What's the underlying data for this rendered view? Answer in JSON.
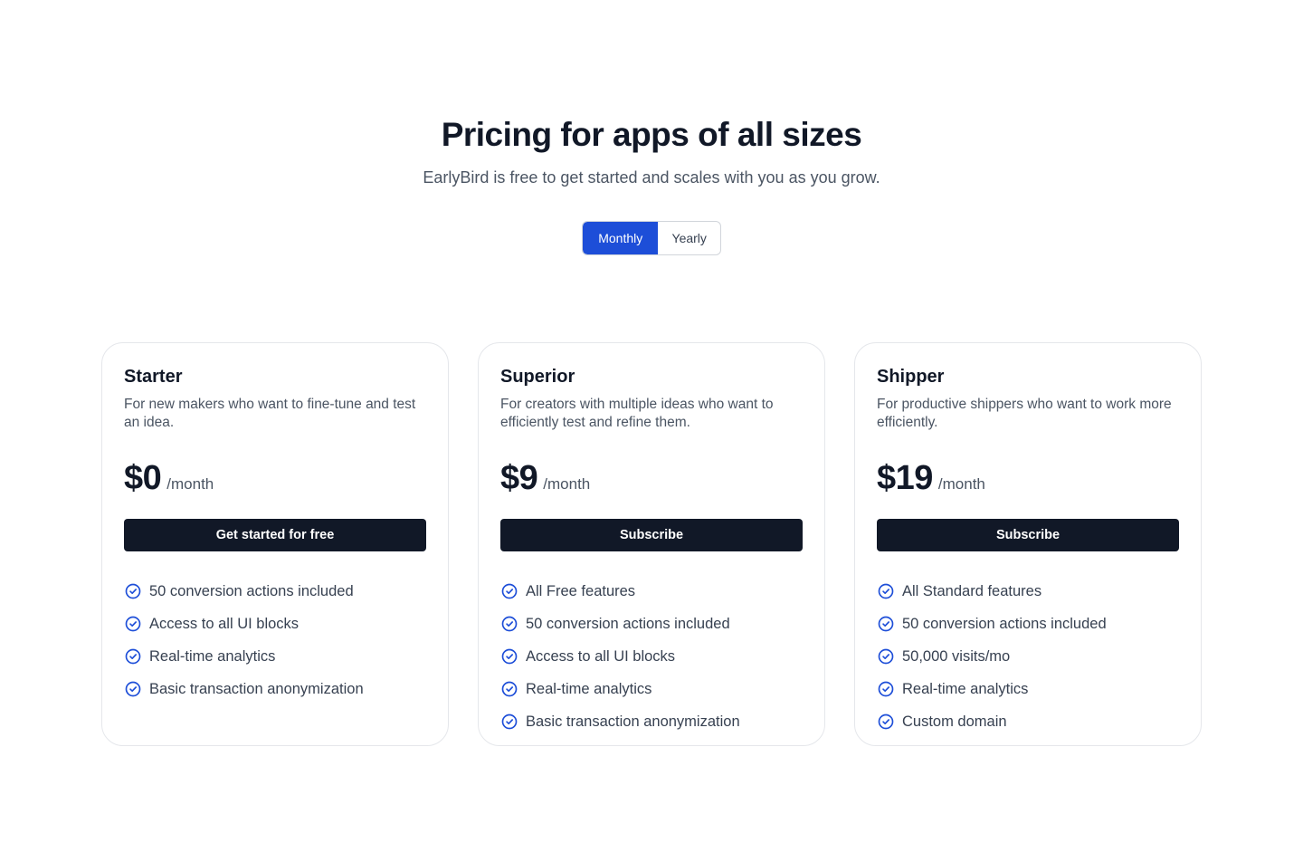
{
  "header": {
    "title": "Pricing for apps of all sizes",
    "subtitle": "EarlyBird is free to get started and scales with you as you grow."
  },
  "billing_toggle": {
    "options": [
      "Monthly",
      "Yearly"
    ],
    "selected": "Monthly"
  },
  "colors": {
    "accent": "#1d4ed8",
    "button_dark": "#111827",
    "text_muted": "#4b5563"
  },
  "plans": [
    {
      "name": "Starter",
      "description": "For new makers who want to fine-tune and test an idea.",
      "price": "$0",
      "period": "/month",
      "cta": "Get started for free",
      "features": [
        "50 conversion actions included",
        "Access to all UI blocks",
        "Real-time analytics",
        "Basic transaction anonymization"
      ]
    },
    {
      "name": "Superior",
      "description": "For creators with multiple ideas who want to efficiently test and refine them.",
      "price": "$9",
      "period": "/month",
      "cta": "Subscribe",
      "features": [
        "All Free features",
        "50 conversion actions included",
        "Access to all UI blocks",
        "Real-time analytics",
        "Basic transaction anonymization"
      ]
    },
    {
      "name": "Shipper",
      "description": "For productive shippers who want to work more efficiently.",
      "price": "$19",
      "period": "/month",
      "cta": "Subscribe",
      "features": [
        "All Standard features",
        "50 conversion actions included",
        "50,000 visits/mo",
        "Real-time analytics",
        "Custom domain"
      ]
    }
  ],
  "icons": {
    "feature": "check-circle-icon"
  }
}
